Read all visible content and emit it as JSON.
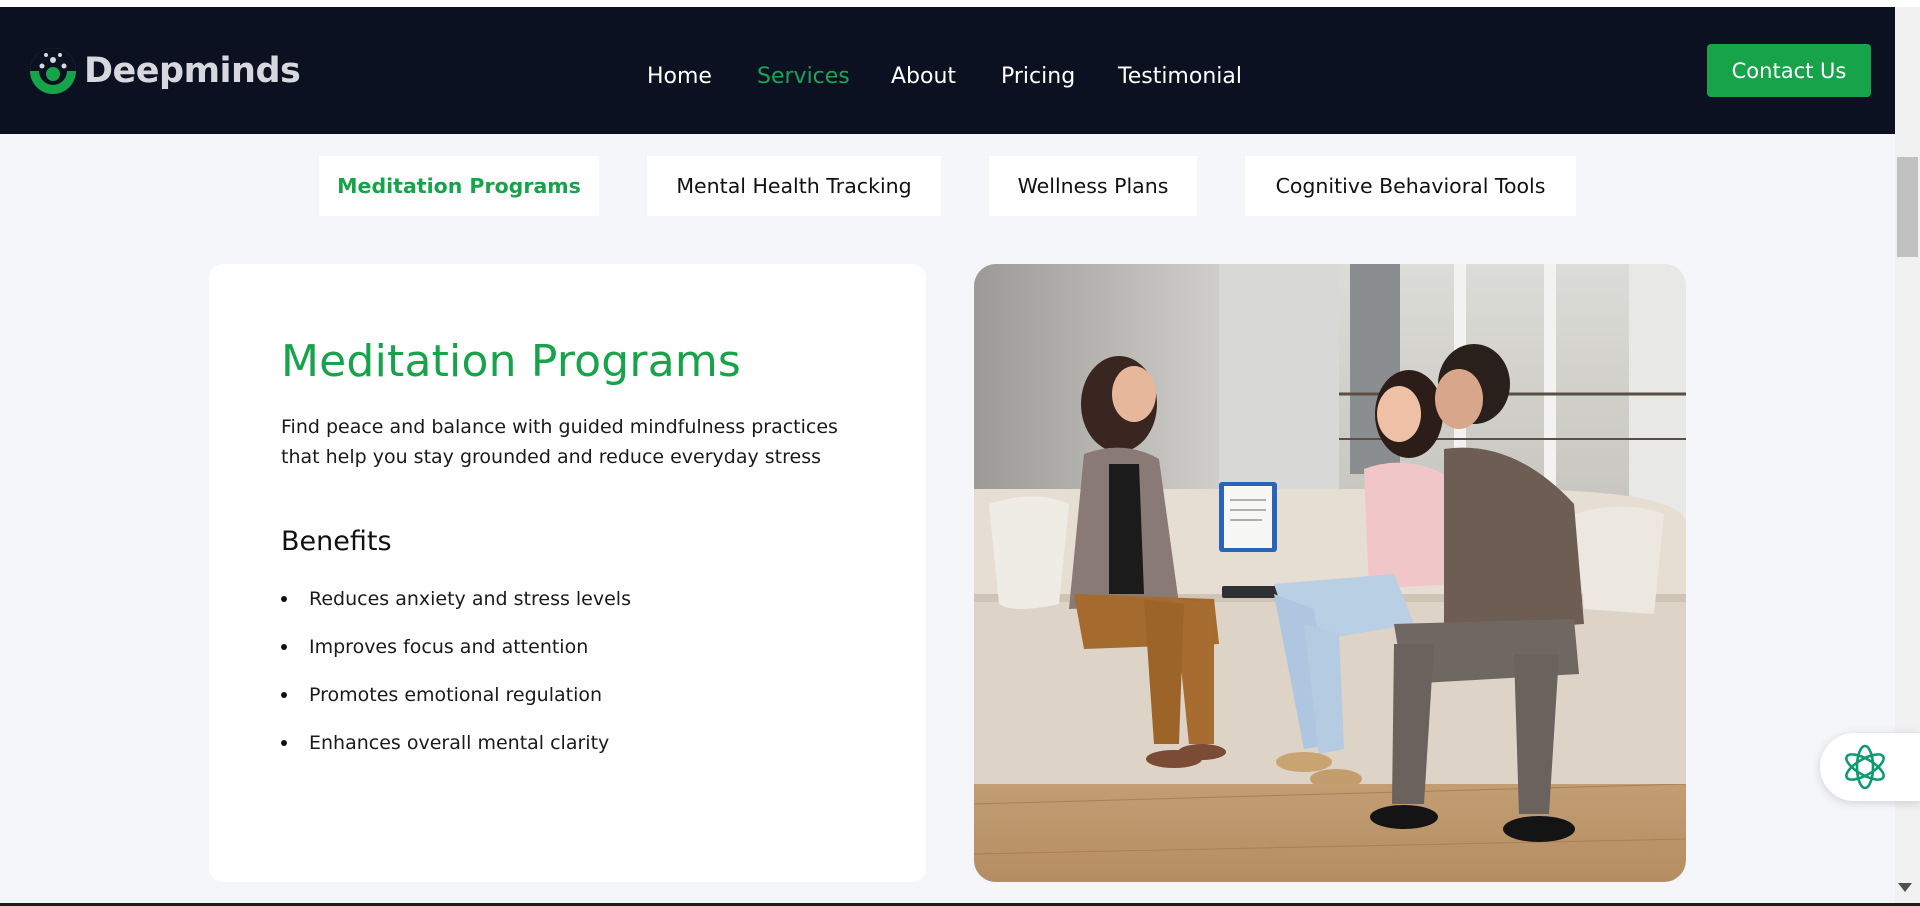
{
  "brand": {
    "name": "Deepminds",
    "accent": "#16a34a",
    "header_bg": "#0c1122"
  },
  "nav": {
    "items": [
      {
        "label": "Home"
      },
      {
        "label": "Services"
      },
      {
        "label": "About"
      },
      {
        "label": "Pricing"
      },
      {
        "label": "Testimonial"
      }
    ],
    "active": "Services",
    "contact_label": "Contact Us"
  },
  "tabs": {
    "items": [
      {
        "label": "Meditation Programs"
      },
      {
        "label": "Mental Health Tracking"
      },
      {
        "label": "Wellness Plans"
      },
      {
        "label": "Cognitive Behavioral Tools"
      }
    ],
    "active": "Meditation Programs"
  },
  "service": {
    "title": "Meditation Programs",
    "description": "Find peace and balance with guided mindfulness practices that help you stay grounded and reduce everyday stress",
    "benefits_title": "Benefits",
    "benefits": [
      "Reduces anxiety and stress levels",
      "Improves focus and attention",
      "Promotes emotional regulation",
      "Enhances overall mental clarity"
    ]
  },
  "icons": {
    "logo": "brain-gear-logo-icon",
    "assistant": "ai-sparkle-icon"
  }
}
